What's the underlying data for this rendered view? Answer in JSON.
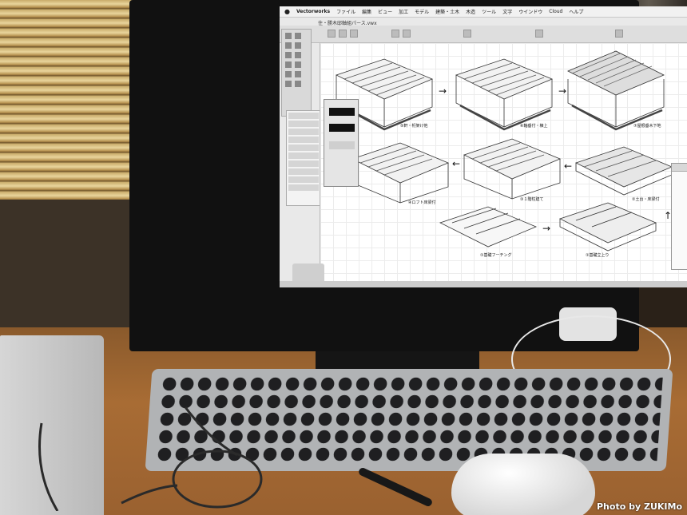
{
  "photo": {
    "credit": "Photo by ZUKIMo"
  },
  "app": {
    "name": "Vectorworks",
    "menus": [
      "ファイル",
      "編集",
      "ビュー",
      "加工",
      "モデル",
      "建築・土木",
      "木造",
      "ツール",
      "文字",
      "ウインドウ",
      "Cloud",
      "ヘルプ"
    ],
    "document_title": "住・勝木邸軸組パース.vwx"
  },
  "drawing": {
    "frames": [
      {
        "label": "⑤軒・桁架け他"
      },
      {
        "label": "⑥軸垂付・棟上"
      },
      {
        "label": "⑦屋根垂木下地"
      },
      {
        "label": "④ロフト床梁付"
      },
      {
        "label": "③１階柱建て"
      },
      {
        "label": "②土台・床梁付"
      },
      {
        "label": "①基礎フーチング"
      },
      {
        "label": "①基礎立上り"
      }
    ]
  },
  "colors": {
    "screen_bg": "#e9e9e9",
    "desk": "#a86c34",
    "keyboard_body": "#b1b3b5",
    "keys": "#1f1f21"
  }
}
